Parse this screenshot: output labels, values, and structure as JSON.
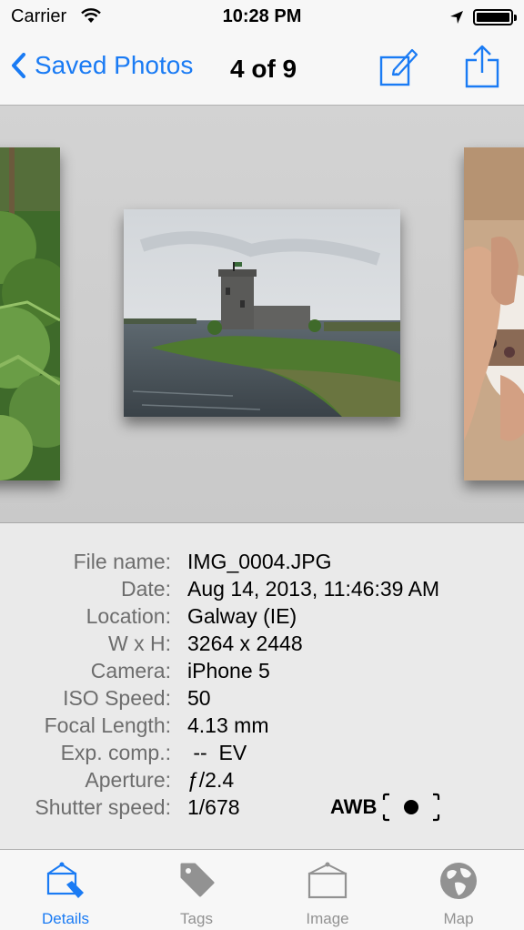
{
  "status_bar": {
    "carrier": "Carrier",
    "time": "10:28 PM"
  },
  "nav": {
    "back_label": "Saved Photos",
    "counter": "4 of 9"
  },
  "details": {
    "rows": [
      {
        "label": "File name:",
        "value": "IMG_0004.JPG"
      },
      {
        "label": "Date:",
        "value": "Aug 14, 2013, 11:46:39 AM"
      },
      {
        "label": "Location:",
        "value": "Galway (IE)"
      },
      {
        "label": "W x H:",
        "value": "3264 x 2448"
      },
      {
        "label": "Camera:",
        "value": "iPhone 5"
      },
      {
        "label": "ISO Speed:",
        "value": "50"
      },
      {
        "label": "Focal Length:",
        "value": "4.13 mm"
      },
      {
        "label": "Exp. comp.:",
        "value": " --  EV"
      },
      {
        "label": "Aperture:",
        "value": "ƒ/2.4"
      },
      {
        "label": "Shutter speed:",
        "value": "1/678"
      }
    ],
    "awb": "AWB"
  },
  "tabs": [
    {
      "label": "Details",
      "icon": "details-icon",
      "active": true
    },
    {
      "label": "Tags",
      "icon": "tag-icon",
      "active": false
    },
    {
      "label": "Image",
      "icon": "image-icon",
      "active": false
    },
    {
      "label": "Map",
      "icon": "globe-icon",
      "active": false
    }
  ],
  "colors": {
    "accent": "#1a7bf4",
    "inactive": "#929292"
  }
}
